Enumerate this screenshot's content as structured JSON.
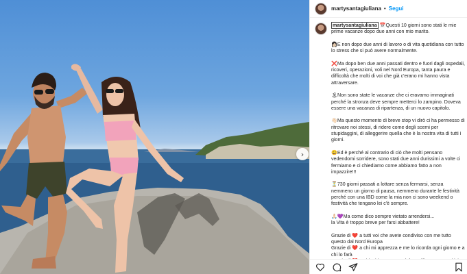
{
  "post": {
    "username": "martysantagiuliana",
    "follow_label": "Segui",
    "separator": "•"
  },
  "caption": {
    "username": "martysantagiuliana",
    "paragraphs": [
      "📅Questi 10 giorni sono stati le mie prime vacanze dopo due anni con mio marito.",
      "👩🏻E non dopo due anni di lavoro o di vita quotidiana con tutto lo stress che si può avere normalmente.",
      "❌Ma dopo ben due anni passati dentro e fuori dagli ospedali, ricoveri, operazioni, voli nel Nord Europa, tanta paura e difficoltà che molti di voi che già c'erano mi hanno vista attraversare.",
      "🏝Non sono state le vacanze che ci eravamo immaginati perché la stronza deve sempre metterci lo zampino. Doveva essere una vacanza di ripartenza, di un nuovo capitolo.",
      "👋🏻Ma questo momento di breve stop vi dirò ci ha permesso di ritrovare noi stessi, di ridere come degli scemi per stupidaggini, di alleggerire quella che è la nostra vita di tutti i giorni.",
      "😄Ed è perché al contrario di ciò che molti pensano vedendomi sorridere, sono stati due anni durissimi a volte ci fermiamo e ci chiediamo come abbiamo fatto a non impazzire!!!",
      "⏳730 giorni passati a lottare senza fermarsi, senza nemmeno un giorno di pausa, nemmeno durante le festività perché con una IBD come la mia non ci sono weekend o festività che tengano lei c'è sempre.",
      "🙏🏻💜Ma come dico sempre vietato arrendersi...\nla Vita è troppo breve per farsi abbattere!",
      "Grazie di ❤️ a tutti voi che avete condiviso con me tutto questo dal Nord Europa\nGrazie di ❤️ a chi mi apprezza e me lo ricorda ogni giorno e a chi lo farà\nGrazie di ❤️ a chi mi ha spronato è fatta riflettere con critiche costruttive"
    ]
  },
  "icons": {
    "like": "heart-icon",
    "comment": "comment-icon",
    "share": "share-icon",
    "save": "bookmark-icon",
    "next": "chevron-right-icon"
  },
  "colors": {
    "follow_blue": "#0095f6",
    "text": "#262626",
    "divider": "#efefef"
  },
  "next_glyph": "›"
}
